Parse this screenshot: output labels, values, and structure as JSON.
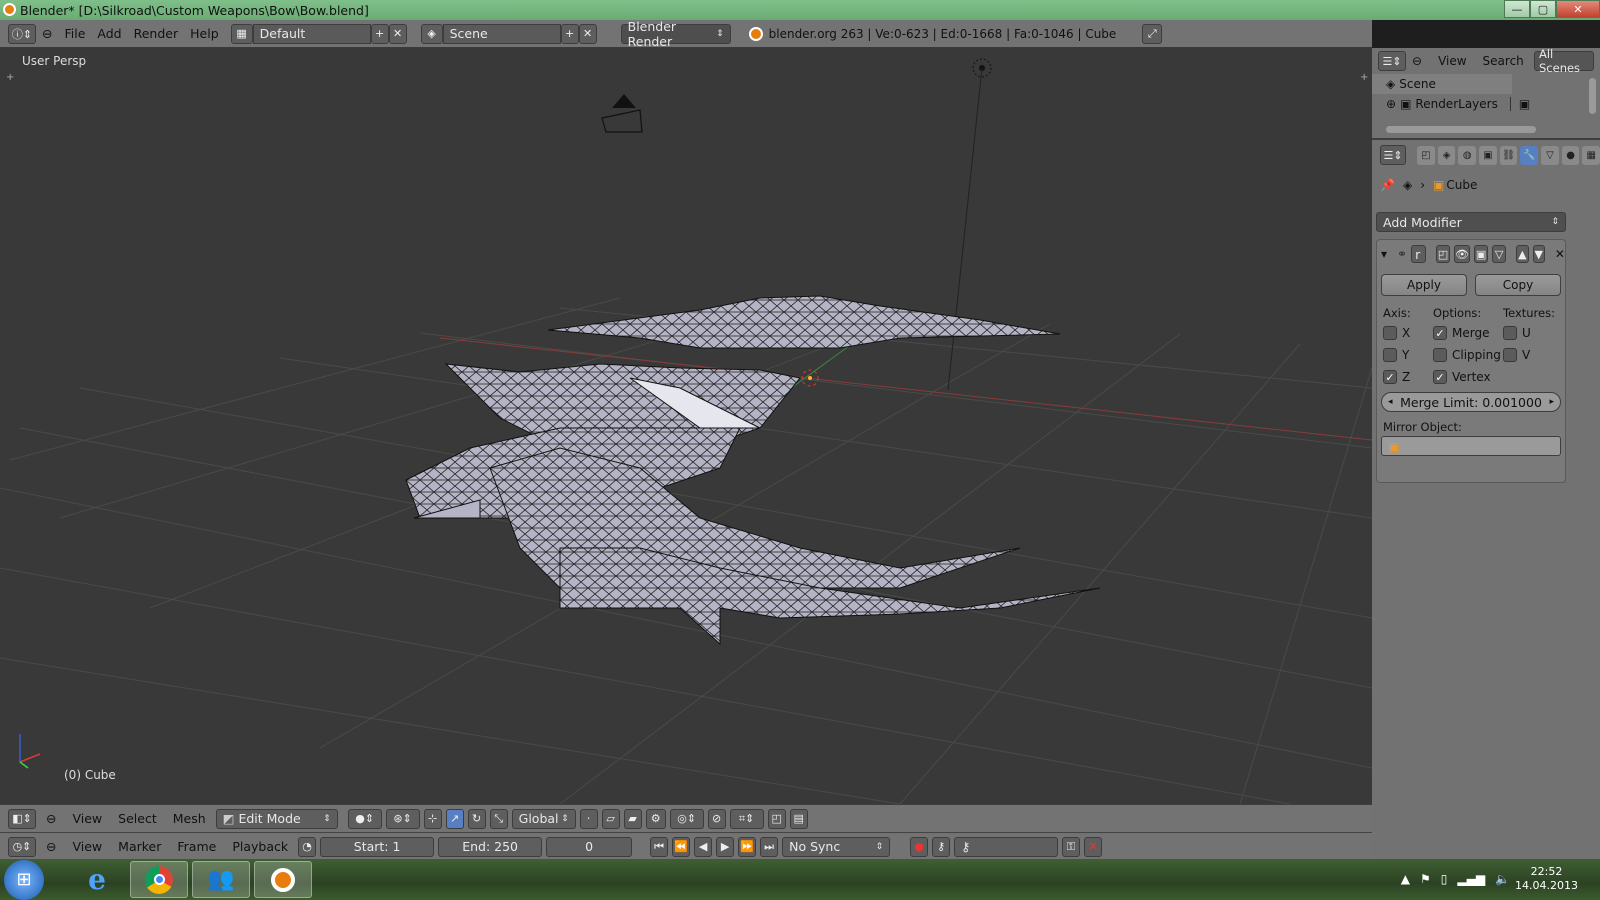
{
  "window": {
    "title": "Blender* [D:\\Silkroad\\Custom Weapons\\Bow\\Bow.blend]",
    "min": "—",
    "max": "▢",
    "close": "✕"
  },
  "header": {
    "menus": [
      "File",
      "Add",
      "Render",
      "Help"
    ],
    "layout": "Default",
    "scene": "Scene",
    "engine": "Blender Render",
    "stats": "blender.org 263 | Ve:0-623 | Ed:0-1668 | Fa:0-1046 | Cube"
  },
  "viewport": {
    "label": "User Persp",
    "object_label": "(0) Cube"
  },
  "outliner": {
    "menus": [
      "View",
      "Search"
    ],
    "display": "All Scenes",
    "items": [
      "Scene",
      "RenderLayers"
    ]
  },
  "properties": {
    "object": "Cube",
    "add_modifier": "Add Modifier",
    "mod_name": "r",
    "apply": "Apply",
    "copy": "Copy",
    "axis_label": "Axis:",
    "options_label": "Options:",
    "textures_label": "Textures:",
    "axis": [
      {
        "label": "X",
        "checked": false
      },
      {
        "label": "Y",
        "checked": false
      },
      {
        "label": "Z",
        "checked": true
      }
    ],
    "options": [
      {
        "label": "Merge",
        "checked": true
      },
      {
        "label": "Clipping",
        "checked": false
      },
      {
        "label": "Vertex",
        "checked": true
      }
    ],
    "textures": [
      {
        "label": "U",
        "checked": false
      },
      {
        "label": "V",
        "checked": false
      }
    ],
    "merge_limit": "Merge Limit: 0.001000",
    "mirror_object_label": "Mirror Object:"
  },
  "view3d_header": {
    "menus": [
      "View",
      "Select",
      "Mesh"
    ],
    "mode": "Edit Mode",
    "orientation": "Global"
  },
  "timeline": {
    "menus": [
      "View",
      "Marker",
      "Frame",
      "Playback"
    ],
    "start": "Start: 1",
    "end": "End: 250",
    "frame": "0",
    "sync": "No Sync"
  },
  "taskbar": {
    "time": "22:52",
    "date": "14.04.2013"
  }
}
